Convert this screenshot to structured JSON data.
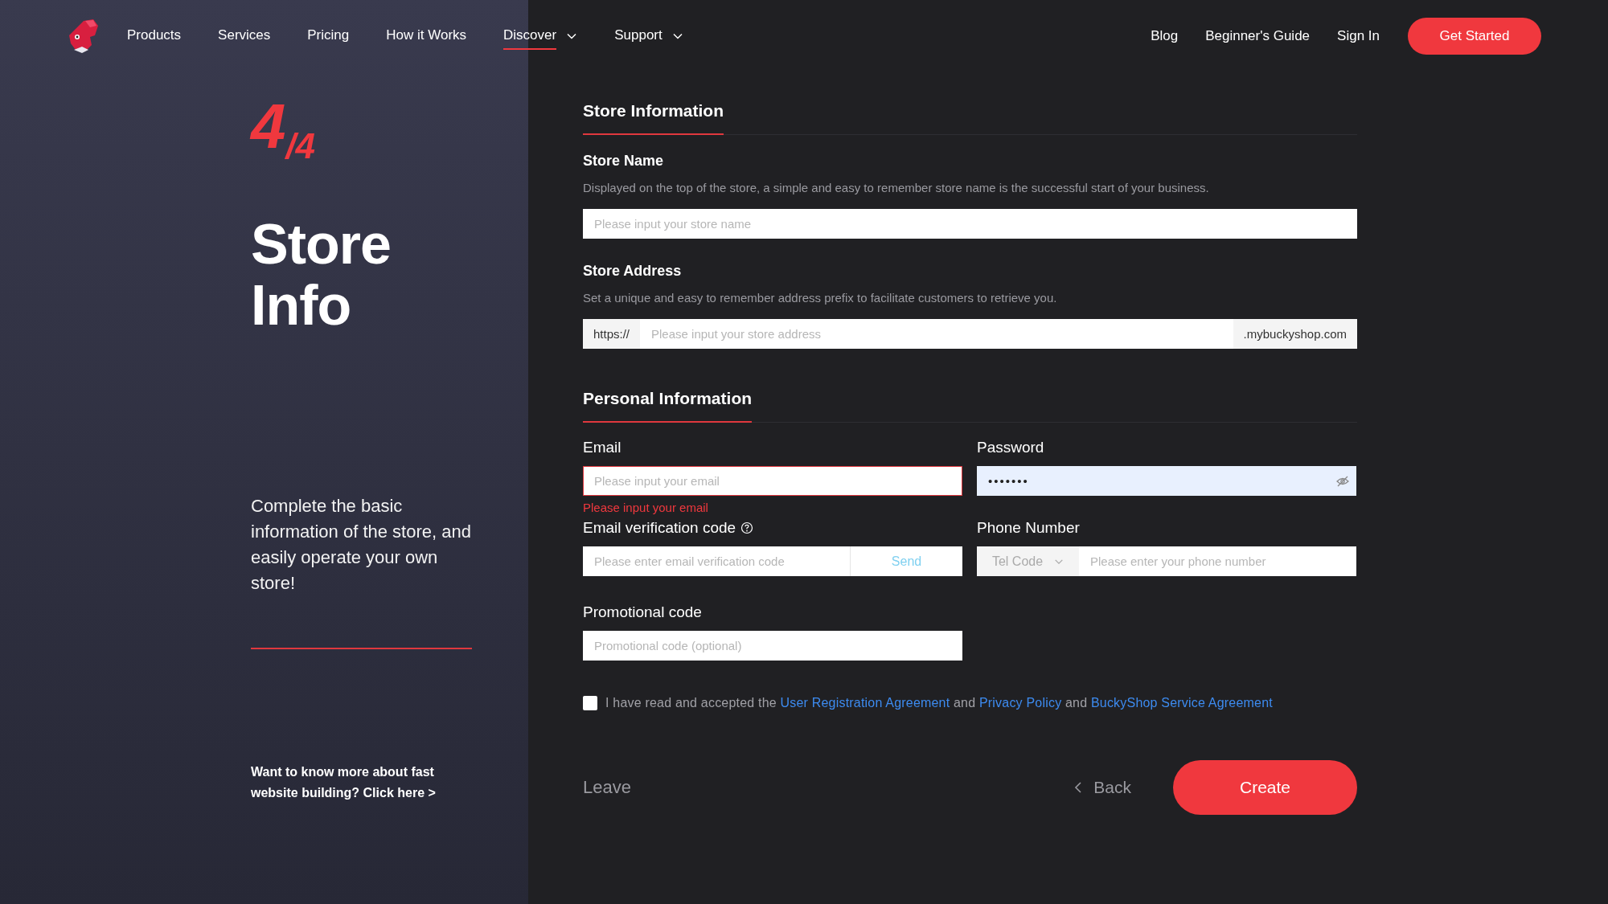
{
  "nav": {
    "items": [
      {
        "label": "Products",
        "selected": false,
        "dropdown": false
      },
      {
        "label": "Services",
        "selected": false,
        "dropdown": false
      },
      {
        "label": "Pricing",
        "selected": false,
        "dropdown": false
      },
      {
        "label": "How it Works",
        "selected": false,
        "dropdown": false
      },
      {
        "label": "Discover",
        "selected": true,
        "dropdown": true
      },
      {
        "label": "Support",
        "selected": false,
        "dropdown": true
      }
    ],
    "right_links": [
      "Blog",
      "Beginner's Guide",
      "Sign In"
    ],
    "cta": "Get Started"
  },
  "side": {
    "step": "4",
    "total": "/4",
    "title_lines": [
      "Store",
      "Info"
    ],
    "description": "Complete the basic information of the store, and easily operate your own store!",
    "footer_link": "Want to know more about fast website building? Click here >"
  },
  "store_section": {
    "title": "Store Information",
    "store_name": {
      "label": "Store Name",
      "description": "Displayed on the top of the store, a simple and easy to remember store name is the successful start of your business.",
      "placeholder": "Please input your store name"
    },
    "store_address": {
      "label": "Store Address",
      "description": "Set a unique and easy to remember address prefix to facilitate customers to retrieve you.",
      "prefix": "https://",
      "placeholder": "Please input your store address",
      "suffix": ".mybuckyshop.com"
    }
  },
  "personal_section": {
    "title": "Personal Information",
    "email": {
      "label": "Email",
      "placeholder": "Please input your email",
      "invalid": true,
      "error": "Please input your email"
    },
    "password": {
      "label": "Password",
      "value": "•••••••",
      "autofilled": true
    },
    "verification": {
      "label": "Email verification code",
      "placeholder": "Please enter email verification code",
      "button": "Send"
    },
    "phone": {
      "label": "Phone Number",
      "code_placeholder": "Tel Code",
      "placeholder": "Please enter your phone number"
    },
    "promo": {
      "label": "Promotional code",
      "placeholder": "Promotional code (optional)"
    }
  },
  "agreement": {
    "checked": false,
    "text": "I have read and accepted the",
    "links": [
      "User Registration Agreement",
      "Privacy Policy",
      "BuckyShop Service Agreement"
    ],
    "joiners": [
      "and",
      "and"
    ]
  },
  "actions": {
    "leave": "Leave",
    "back": "Back",
    "create": "Create"
  }
}
